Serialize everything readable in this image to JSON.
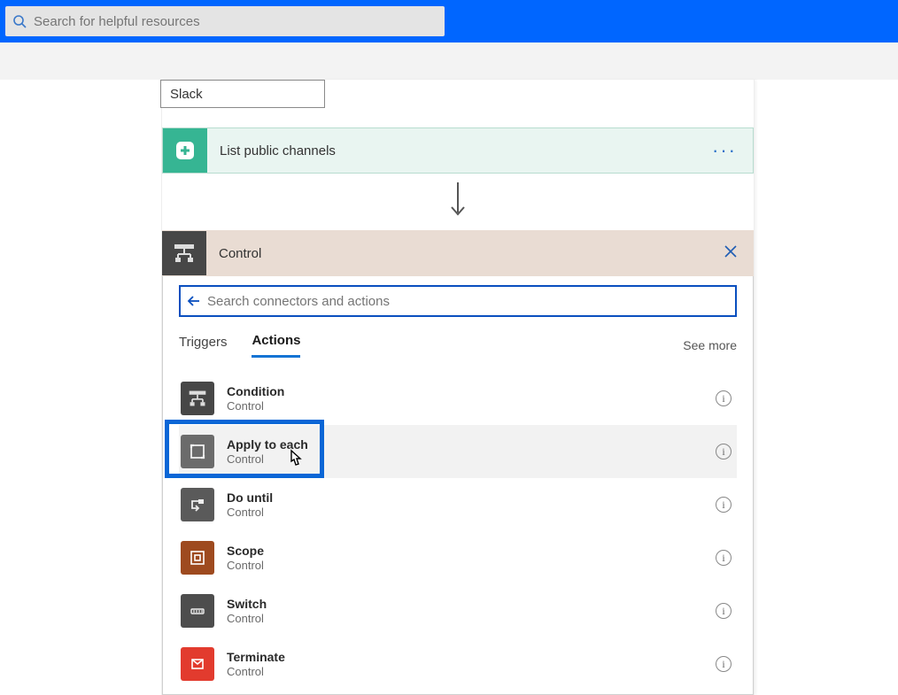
{
  "topbar": {
    "search_placeholder": "Search for helpful resources"
  },
  "slack_input_value": "Slack",
  "trigger": {
    "title": "List public channels"
  },
  "control_panel": {
    "title": "Control",
    "search_placeholder": "Search connectors and actions",
    "tabs": {
      "triggers": "Triggers",
      "actions": "Actions"
    },
    "see_more": "See more",
    "items": [
      {
        "title": "Condition",
        "sub": "Control",
        "bg": "#474747",
        "icon": "branch"
      },
      {
        "title": "Apply to each",
        "sub": "Control",
        "bg": "#6b6b6b",
        "icon": "loop"
      },
      {
        "title": "Do until",
        "sub": "Control",
        "bg": "#5a5a5a",
        "icon": "until"
      },
      {
        "title": "Scope",
        "sub": "Control",
        "bg": "#9e4a1f",
        "icon": "scope"
      },
      {
        "title": "Switch",
        "sub": "Control",
        "bg": "#4d4d4d",
        "icon": "switch"
      },
      {
        "title": "Terminate",
        "sub": "Control",
        "bg": "#e23b2e",
        "icon": "terminate"
      }
    ]
  }
}
